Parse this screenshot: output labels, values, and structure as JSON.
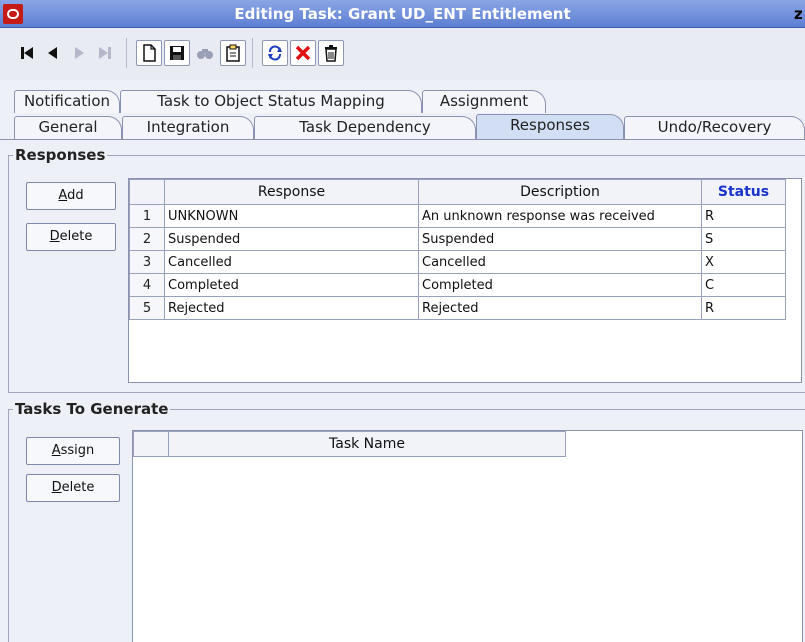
{
  "window": {
    "title": "Editing Task: Grant UD_ENT Entitlement",
    "title_overflow": "z"
  },
  "toolbar": {
    "buttons": [
      {
        "name": "first-record-icon"
      },
      {
        "name": "previous-record-icon"
      },
      {
        "name": "next-record-icon"
      },
      {
        "name": "last-record-icon"
      },
      {
        "name": "new-document-icon"
      },
      {
        "name": "save-icon"
      },
      {
        "name": "find-icon"
      },
      {
        "name": "clipboard-icon"
      },
      {
        "name": "refresh-icon"
      },
      {
        "name": "delete-x-icon"
      },
      {
        "name": "trash-icon"
      }
    ]
  },
  "tabs": {
    "row1": [
      "Notification",
      "Task to Object Status Mapping",
      "Assignment"
    ],
    "row2": [
      "General",
      "Integration",
      "Task Dependency",
      "Responses",
      "Undo/Recovery"
    ],
    "active": "Responses"
  },
  "responses": {
    "title": "Responses",
    "add_label": "Add",
    "add_mnemonic": "A",
    "delete_label": "Delete",
    "delete_mnemonic": "D",
    "columns": [
      "Response",
      "Description",
      "Status"
    ],
    "rows": [
      {
        "n": "1",
        "response": "UNKNOWN",
        "description": "An unknown response was received",
        "status": "R"
      },
      {
        "n": "2",
        "response": "Suspended",
        "description": "Suspended",
        "status": "S"
      },
      {
        "n": "3",
        "response": "Cancelled",
        "description": "Cancelled",
        "status": "X"
      },
      {
        "n": "4",
        "response": "Completed",
        "description": "Completed",
        "status": "C"
      },
      {
        "n": "5",
        "response": "Rejected",
        "description": "Rejected",
        "status": "R"
      }
    ]
  },
  "tasks": {
    "title": "Tasks To Generate",
    "assign_label": "Assign",
    "assign_mnemonic": "A",
    "delete_label": "Delete",
    "delete_mnemonic": "D",
    "columns": [
      "Task Name"
    ]
  },
  "colors": {
    "titlebar": "#5d7fd2",
    "active_tab": "#d2def3",
    "status_header": "#1a33cc",
    "logo_red": "#c41b16"
  }
}
